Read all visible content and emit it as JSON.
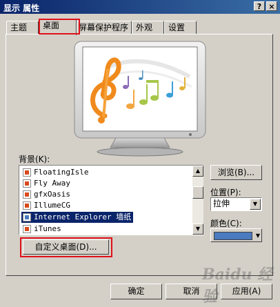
{
  "window": {
    "title": "显示 属性",
    "help_button": "?",
    "close_button": "×"
  },
  "tabs": [
    {
      "label": "主题"
    },
    {
      "label": "桌面"
    },
    {
      "label": "屏幕保护程序"
    },
    {
      "label": "外观"
    },
    {
      "label": "设置"
    }
  ],
  "background": {
    "label": "背景(K):",
    "items": [
      {
        "label": "FloatingIsle"
      },
      {
        "label": "Fly Away"
      },
      {
        "label": "gfxOasis"
      },
      {
        "label": "IllumeCG"
      },
      {
        "label": "Internet Explorer 墙纸"
      },
      {
        "label": "iTunes"
      }
    ]
  },
  "browse_button": "浏览(B)...",
  "position": {
    "label": "位置(P):",
    "value": "拉伸"
  },
  "color": {
    "label": "颜色(C):",
    "value": "#4a7abf"
  },
  "customize_button": "自定义桌面(D)...",
  "footer": {
    "ok": "确定",
    "cancel": "取消",
    "apply": "应用(A)"
  },
  "watermark": "Baidu 经验",
  "colors": {
    "accent_red": "#e0101a",
    "selection": "#0a246a",
    "title_bar": "#0a246a"
  }
}
